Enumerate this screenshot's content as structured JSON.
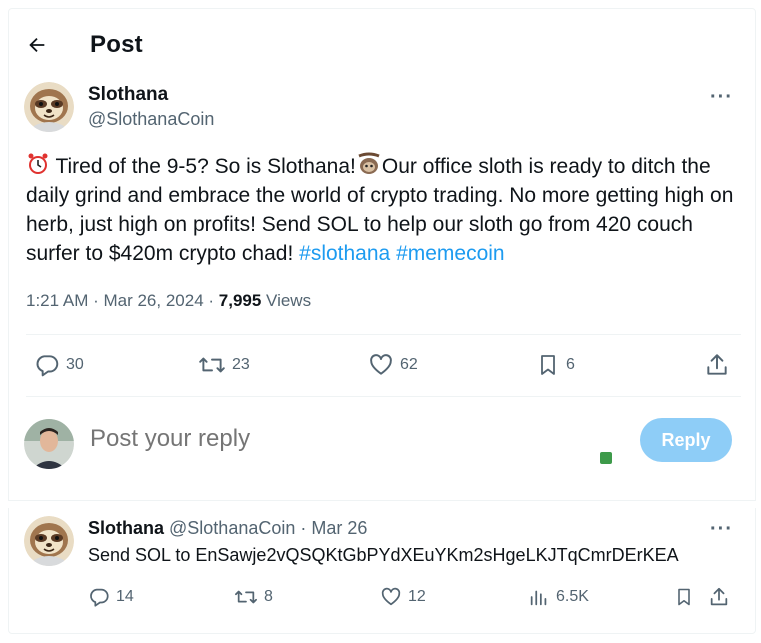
{
  "header": {
    "title": "Post",
    "back_icon": "arrow-left-icon"
  },
  "tweet": {
    "author_name": "Slothana",
    "author_handle": "@SlothanaCoin",
    "more_label": "···",
    "text_part1": " Tired of the 9-5? So is Slothana!",
    "text_part2": "Our office sloth is ready to ditch the daily grind and embrace the world of crypto trading. No more getting high on herb, just high on profits! Send SOL to help our sloth go from 420 couch surfer to $420m crypto chad!  ",
    "hashtag1": "#slothana",
    "hashtag2": "#memecoin",
    "time": "1:21 AM · Mar 26, 2024 · ",
    "views_count": "7,995",
    "views_label": " Views",
    "actions": {
      "replies": "30",
      "reposts": "23",
      "likes": "62",
      "bookmarks": "6"
    }
  },
  "composer": {
    "placeholder": "Post your reply",
    "reply_button": "Reply"
  },
  "reply": {
    "author_name": "Slothana",
    "author_handle": " @SlothanaCoin · Mar 26",
    "more_label": "···",
    "text": "Send SOL to EnSawje2vQSQKtGbPYdXEuYKm2sHgeLKJTqCmrDErKEA",
    "actions": {
      "replies": "14",
      "reposts": "8",
      "likes": "12",
      "views": "6.5K"
    }
  },
  "colors": {
    "accent": "#1d9bf0",
    "muted": "#536471",
    "reply_button_bg": "#8ecdf7"
  }
}
